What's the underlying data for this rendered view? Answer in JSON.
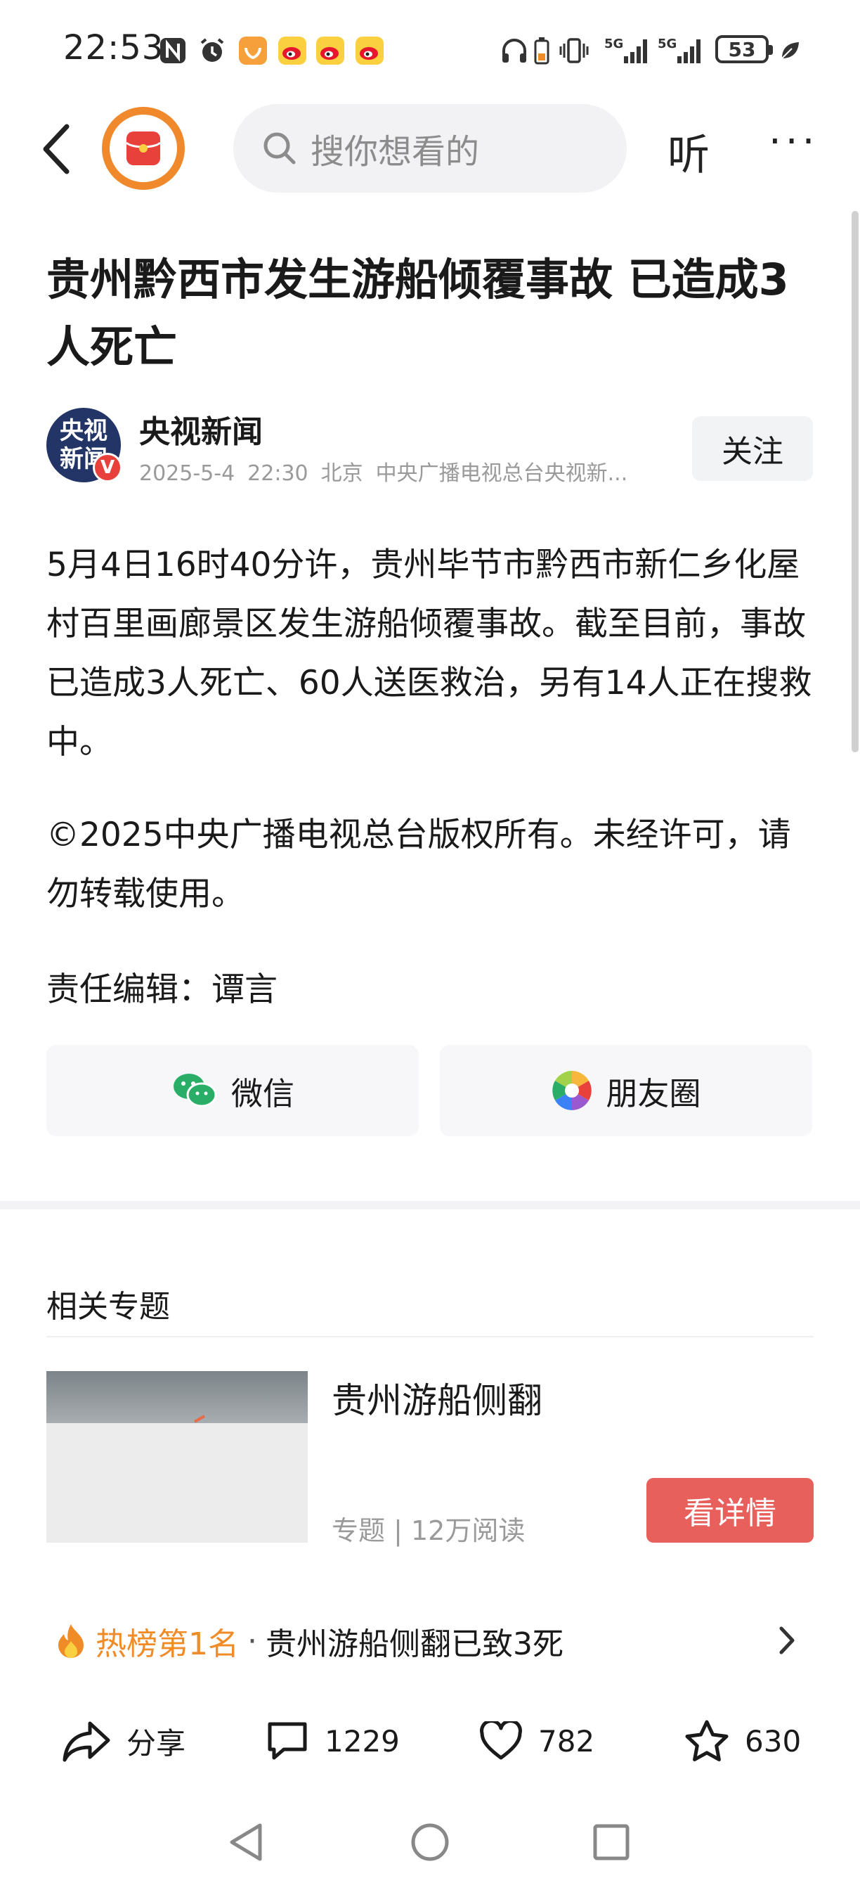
{
  "status_bar": {
    "time": "22:53",
    "left_icons": [
      "nfc-icon",
      "alarm-icon",
      "app-notification-icon",
      "weibo-icon",
      "weibo-icon",
      "weibo-icon"
    ],
    "right_icons": [
      "headphones-icon",
      "battery-saver-icon",
      "vibrate-icon",
      "5g-signal-icon",
      "5g-signal-icon",
      "leaf-icon"
    ],
    "network_1": "5G",
    "network_2": "5G",
    "battery": "53"
  },
  "top_nav": {
    "search_placeholder": "搜你想看的",
    "listen_label": "听",
    "more_label": "···"
  },
  "article": {
    "title": "贵州黔西市发生游船倾覆事故 已造成3人死亡",
    "source": {
      "name": "央视新闻",
      "avatar_text": "央视新闻",
      "verified_badge": "V",
      "date": "2025-5-4",
      "time": "22:30",
      "location": "北京",
      "publisher": "中央广播电视总台央视新..."
    },
    "follow_label": "关注",
    "paragraphs": [
      "5月4日16时40分许，贵州毕节市黔西市新仁乡化屋村百里画廊景区发生游船倾覆事故。截至目前，事故已造成3人死亡、60人送医救治，另有14人正在搜救中。",
      "©2025中央广播电视总台版权所有。未经许可，请勿转载使用。"
    ],
    "editor": "责任编辑：谭言"
  },
  "share": {
    "wechat_label": "微信",
    "moments_label": "朋友圈"
  },
  "related": {
    "section_title": "相关专题",
    "topic_title": "贵州游船侧翻",
    "topic_meta": "专题 | 12万阅读",
    "detail_button": "看详情"
  },
  "hot": {
    "rank": "热榜第1名",
    "separator": "·",
    "title": "贵州游船侧翻已致3死"
  },
  "actions": {
    "share_label": "分享",
    "comments": "1229",
    "likes": "782",
    "favorites": "630"
  },
  "colors": {
    "accent_orange": "#f08c28",
    "detail_button": "#e8605c",
    "avatar_bg": "#223566"
  }
}
